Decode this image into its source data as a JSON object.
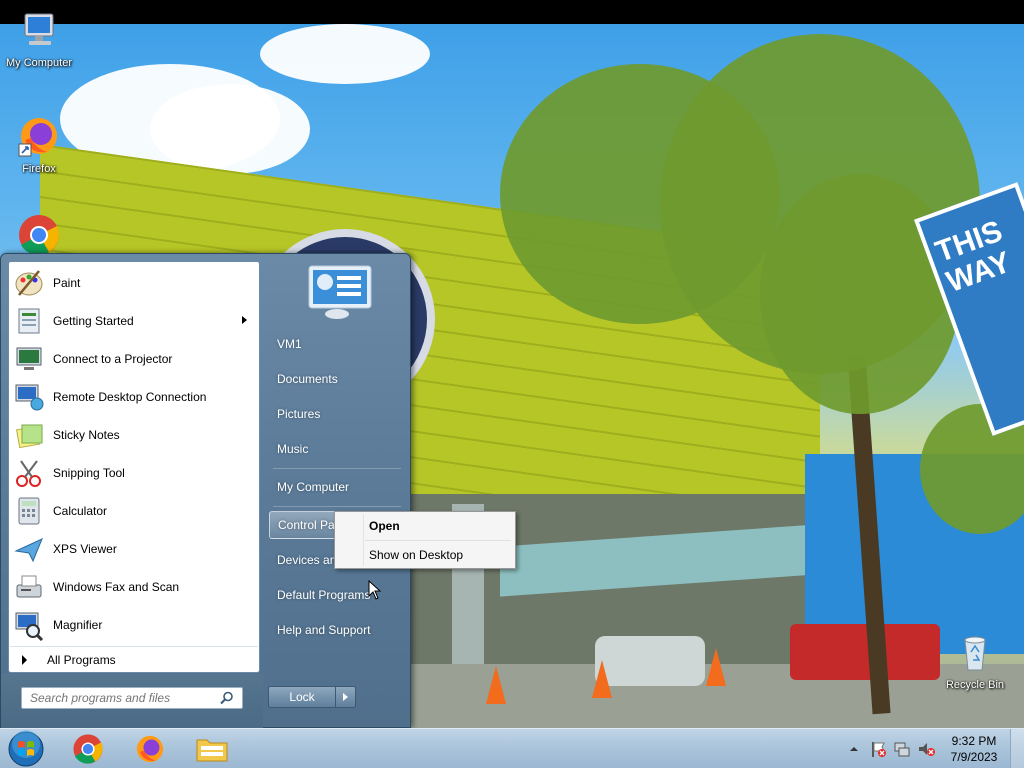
{
  "desktop": {
    "icons": [
      {
        "label": "My Computer",
        "icon": "computer-icon"
      },
      {
        "label": "Firefox",
        "icon": "firefox-icon"
      },
      {
        "label": "",
        "icon": "chrome-icon"
      },
      {
        "label": "Recycle Bin",
        "icon": "recycle-bin-icon"
      }
    ],
    "wallpaper_sign_text": "THIS WAY"
  },
  "start_menu": {
    "programs": [
      {
        "label": "Paint",
        "icon": "paint-icon",
        "submenu": false
      },
      {
        "label": "Getting Started",
        "icon": "getting-started-icon",
        "submenu": true
      },
      {
        "label": "Connect to a Projector",
        "icon": "projector-icon",
        "submenu": false
      },
      {
        "label": "Remote Desktop Connection",
        "icon": "remote-desktop-icon",
        "submenu": false
      },
      {
        "label": "Sticky Notes",
        "icon": "sticky-notes-icon",
        "submenu": false
      },
      {
        "label": "Snipping Tool",
        "icon": "snipping-tool-icon",
        "submenu": false
      },
      {
        "label": "Calculator",
        "icon": "calculator-icon",
        "submenu": false
      },
      {
        "label": "XPS Viewer",
        "icon": "xps-viewer-icon",
        "submenu": false
      },
      {
        "label": "Windows Fax and Scan",
        "icon": "fax-scan-icon",
        "submenu": false
      },
      {
        "label": "Magnifier",
        "icon": "magnifier-icon",
        "submenu": false
      }
    ],
    "all_programs_label": "All Programs",
    "search_placeholder": "Search programs and files",
    "right_items": [
      {
        "label": "VM1"
      },
      {
        "label": "Documents"
      },
      {
        "label": "Pictures"
      },
      {
        "label": "Music"
      },
      {
        "label": "My Computer"
      },
      {
        "label": "Control Panel"
      },
      {
        "label": "Devices and Printers"
      },
      {
        "label": "Default Programs"
      },
      {
        "label": "Help and Support"
      }
    ],
    "highlighted_item": "Control Panel",
    "lock_label": "Lock"
  },
  "context_menu": {
    "items": [
      {
        "label": "Open",
        "bold": true
      },
      {
        "label": "Show on Desktop",
        "bold": false
      }
    ]
  },
  "taskbar": {
    "pinned": [
      {
        "name": "chrome",
        "icon": "chrome-icon"
      },
      {
        "name": "firefox",
        "icon": "firefox-icon"
      },
      {
        "name": "explorer",
        "icon": "folder-icon"
      }
    ],
    "tray": [
      {
        "icon": "chevron-up-icon"
      },
      {
        "icon": "action-center-flag-icon"
      },
      {
        "icon": "network-icon"
      },
      {
        "icon": "volume-muted-icon"
      }
    ],
    "clock": {
      "time": "9:32 PM",
      "date": "7/9/2023"
    }
  },
  "colors": {
    "taskbar": "#a9c3da",
    "start_menu_right": "#5d7d9b",
    "highlight": "#ffffff"
  }
}
